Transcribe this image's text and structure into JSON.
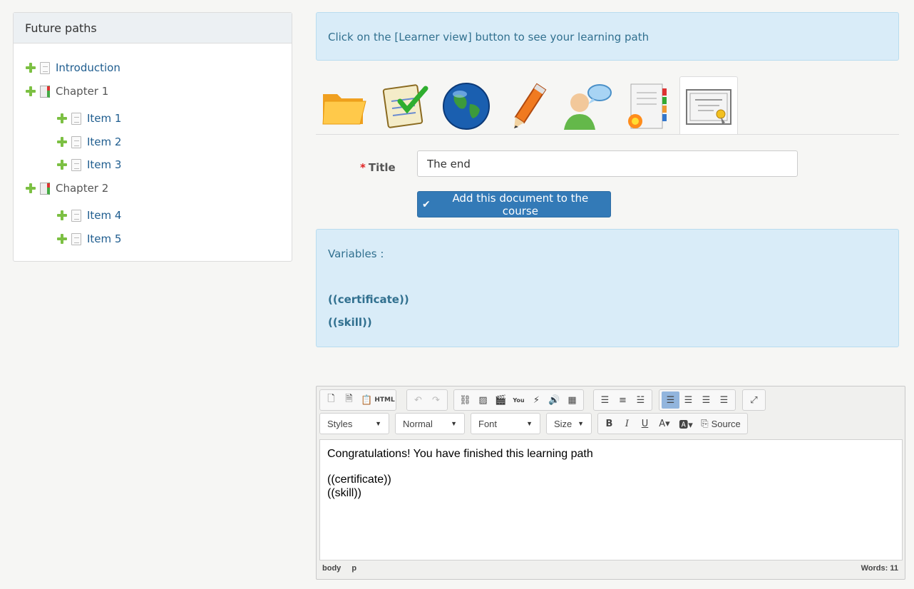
{
  "sidebar": {
    "title": "Future paths",
    "items": [
      {
        "label": "Introduction",
        "type": "document"
      },
      {
        "label": "Chapter 1",
        "type": "chapter"
      },
      {
        "label": "Item 1",
        "type": "document"
      },
      {
        "label": "Item 2",
        "type": "document"
      },
      {
        "label": "Item 3",
        "type": "document"
      },
      {
        "label": "Chapter 2",
        "type": "chapter"
      },
      {
        "label": "Item 4",
        "type": "document"
      },
      {
        "label": "Item 5",
        "type": "document"
      }
    ]
  },
  "info_alert": "Click on the [Learner view] button to see your learning path",
  "tabs": [
    {
      "icon": "folder-icon"
    },
    {
      "icon": "checklist-icon"
    },
    {
      "icon": "globe-icon"
    },
    {
      "icon": "pencil-icon"
    },
    {
      "icon": "user-chat-icon"
    },
    {
      "icon": "new-document-icon"
    },
    {
      "icon": "certificate-icon",
      "active": true
    }
  ],
  "form": {
    "title_label": "Title",
    "required_mark": "*",
    "title_value": "The end",
    "submit_label": "Add this document to the course"
  },
  "variables": {
    "heading": "Variables :",
    "items": [
      "((certificate))",
      "((skill))"
    ]
  },
  "editor": {
    "combos": {
      "styles": "Styles",
      "format": "Normal",
      "font": "Font",
      "size": "Size"
    },
    "source_label": "Source",
    "content": {
      "line1": "Congratulations! You have finished this learning path",
      "line2": "((certificate))",
      "line3": "((skill))"
    },
    "status": {
      "path1": "body",
      "path2": "p",
      "words": "Words: 11"
    }
  },
  "colors": {
    "accent": "#337ab7",
    "alert_bg": "#d9ecf8",
    "alert_text": "#31708f",
    "tree_plus": "#7cc043"
  }
}
